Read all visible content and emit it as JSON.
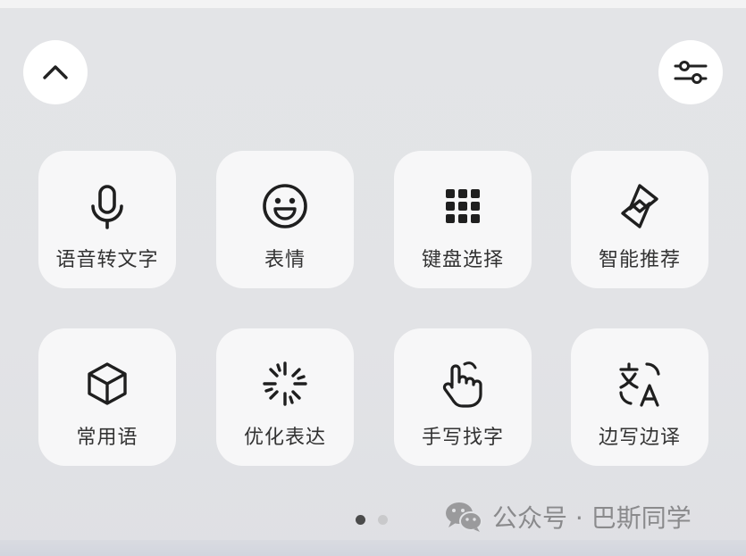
{
  "toolbar": {
    "collapse_icon": "chevron-up-icon",
    "settings_icon": "sliders-icon"
  },
  "tiles": [
    {
      "label": "语音转文字",
      "icon": "microphone-icon"
    },
    {
      "label": "表情",
      "icon": "smiley-face-icon"
    },
    {
      "label": "键盘选择",
      "icon": "keypad-grid-icon"
    },
    {
      "label": "智能推荐",
      "icon": "smart-recommend-icon"
    },
    {
      "label": "常用语",
      "icon": "cube-icon"
    },
    {
      "label": "优化表达",
      "icon": "sparkle-burst-icon"
    },
    {
      "label": "手写找字",
      "icon": "hand-writing-icon"
    },
    {
      "label": "边写边译",
      "icon": "translate-icon"
    }
  ],
  "pager": {
    "pages": 2,
    "active": 1
  },
  "watermark": {
    "text": "公众号 · 巴斯同学",
    "icon": "wechat-logo-icon"
  },
  "colors": {
    "tile": "#f7f7f8",
    "background": "#e2e3e6",
    "text": "#333333"
  }
}
